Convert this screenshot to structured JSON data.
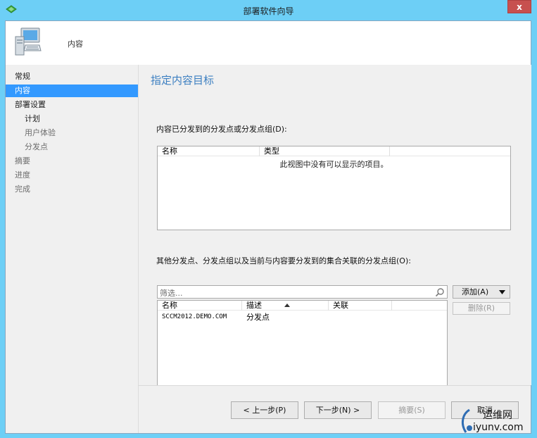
{
  "window": {
    "title": "部署软件向导",
    "close_glyph": "x"
  },
  "header": {
    "label": "内容"
  },
  "sidebar": {
    "items": [
      {
        "label": "常规",
        "state": "active"
      },
      {
        "label": "内容",
        "state": "selected"
      },
      {
        "label": "部署设置",
        "state": "active"
      },
      {
        "label": "计划",
        "state": "active"
      },
      {
        "label": "用户体验",
        "state": "inactive"
      },
      {
        "label": "分发点",
        "state": "inactive"
      },
      {
        "label": "摘要",
        "state": "inactive"
      },
      {
        "label": "进度",
        "state": "inactive"
      },
      {
        "label": "完成",
        "state": "inactive"
      }
    ]
  },
  "main": {
    "title": "指定内容目标",
    "list1": {
      "label": "内容已分发到的分发点或分发点组(D):",
      "columns": [
        "名称",
        "类型"
      ],
      "empty_text": "此视图中没有可以显示的项目。"
    },
    "list2": {
      "label": "其他分发点、分发点组以及当前与内容要分发到的集合关联的分发点组(O):",
      "filter_placeholder": "筛选...",
      "columns": [
        "名称",
        "描述",
        "关联"
      ],
      "rows": [
        {
          "name": "SCCM2012.DEMO.COM",
          "description": "分发点",
          "association": ""
        }
      ]
    },
    "add_button": "添加(A)",
    "delete_button": "删除(R)"
  },
  "footer": {
    "prev": "< 上一步(P)",
    "next": "下一步(N) >",
    "summary": "摘要(S)",
    "cancel": "取消"
  },
  "watermark": {
    "text1": "运维网",
    "text2": "iyunv.com"
  },
  "colors": {
    "titlebar": "#6dcff6",
    "selection": "#3399ff",
    "page_title": "#3c7fc1",
    "panel": "#f0f0f0",
    "close": "#c7504f"
  }
}
